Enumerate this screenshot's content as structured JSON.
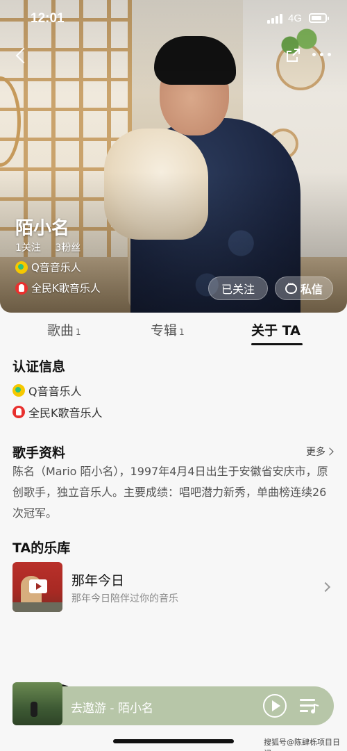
{
  "status_bar": {
    "time": "12:01",
    "network": "4G"
  },
  "profile": {
    "name": "陌小名",
    "follow_count_label": "1关注",
    "fans_count_label": "3粉丝",
    "badges": [
      "Q音音乐人",
      "全民K歌音乐人"
    ],
    "followed_button": "已关注",
    "message_button": "私信"
  },
  "tabs": [
    {
      "label": "歌曲",
      "count": "1"
    },
    {
      "label": "专辑",
      "count": "1"
    },
    {
      "label": "关于 TA",
      "count": ""
    }
  ],
  "certification": {
    "title": "认证信息",
    "items": [
      "Q音音乐人",
      "全民K歌音乐人"
    ]
  },
  "singer_info": {
    "title": "歌手资料",
    "more_label": "更多",
    "bio": "陈名（Mario 陌小名），1997年4月4日出生于安徽省安庆市，原创歌手，独立音乐人。主要成绩：唱吧潜力新秀，单曲榜连续26次冠军。"
  },
  "library": {
    "title": "TA的乐库",
    "playlist": {
      "name": "那年今日",
      "description": "那年今日陪伴过你的音乐"
    }
  },
  "mini_player": {
    "track": "去遨游 - 陌小名"
  },
  "watermark": "搜狐号@陈肆栎项目日记",
  "colors": {
    "accent": "#111111",
    "player_bg": "#b7c6a8",
    "q_icon": "#f6c800",
    "k_icon": "#e8302e"
  },
  "icons": [
    "back-icon",
    "share-icon",
    "more-icon",
    "chat-icon",
    "play-icon",
    "playlist-icon",
    "chevron-right-icon"
  ]
}
